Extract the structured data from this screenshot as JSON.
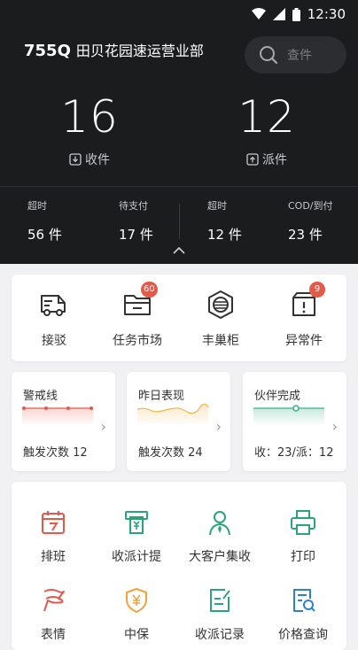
{
  "status_bar": {
    "time": "12:30"
  },
  "station": {
    "code": "755Q",
    "name": "田贝花园速运营业部"
  },
  "search": {
    "placeholder": "查件"
  },
  "stats": {
    "receive": {
      "value": "16",
      "label": "收件"
    },
    "deliver": {
      "value": "12",
      "label": "派件"
    }
  },
  "mini_stats": [
    {
      "title": "超时",
      "value": "56 件"
    },
    {
      "title": "待支付",
      "value": "17 件"
    },
    {
      "title": "超时",
      "value": "12 件"
    },
    {
      "title": "COD/到付",
      "value": "23 件"
    }
  ],
  "quick_actions": [
    {
      "label": "接驳",
      "icon": "truck-icon"
    },
    {
      "label": "任务市场",
      "icon": "folder-icon",
      "badge": "60"
    },
    {
      "label": "丰巢柜",
      "icon": "locker-icon"
    },
    {
      "label": "异常件",
      "icon": "exception-box-icon",
      "badge": "9"
    }
  ],
  "cards": [
    {
      "title": "警戒线",
      "value": "触发次数 12",
      "color": "#e5594b"
    },
    {
      "title": "昨日表现",
      "value": "触发次数 24",
      "color": "#f0b54a"
    },
    {
      "title": "伙伴完成",
      "value": "收：23/派：12",
      "color": "#3bb18e"
    }
  ],
  "tools": [
    {
      "label": "排班",
      "icon": "calendar-icon"
    },
    {
      "label": "收派计提",
      "icon": "atm-icon"
    },
    {
      "label": "大客户集收",
      "icon": "customer-icon"
    },
    {
      "label": "打印",
      "icon": "printer-icon"
    },
    {
      "label": "表情",
      "icon": "flag-icon"
    },
    {
      "label": "中保",
      "icon": "shield-yen-icon"
    },
    {
      "label": "收派记录",
      "icon": "record-icon"
    },
    {
      "label": "价格查询",
      "icon": "price-search-icon"
    }
  ],
  "colors": {
    "header_bg": "#1b1c1e",
    "accent_red": "#e5594b",
    "accent_green": "#2aa57a",
    "accent_orange": "#f0a33a",
    "accent_blue": "#2d7fd6"
  }
}
